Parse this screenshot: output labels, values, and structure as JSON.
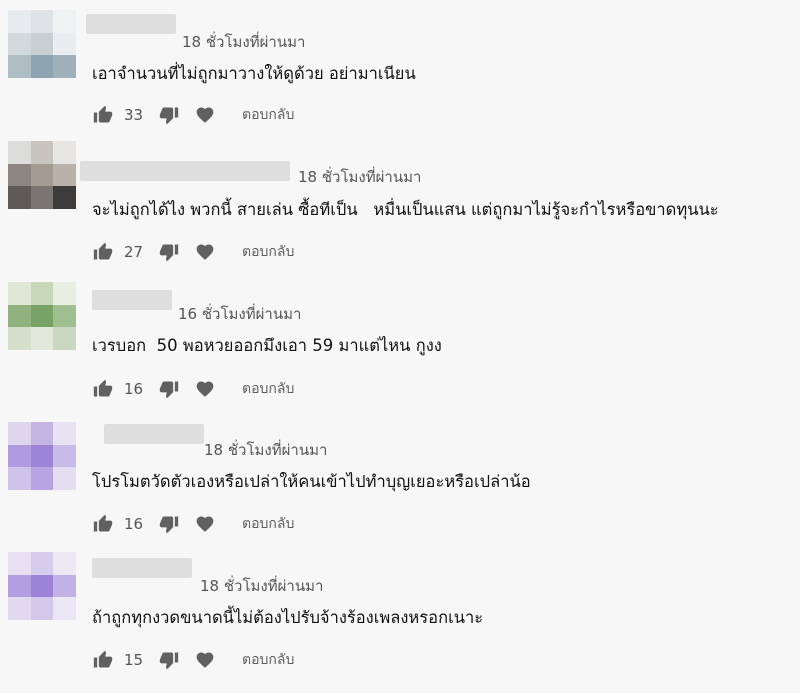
{
  "comments": [
    {
      "time": "18 ชั่วโมงที่ผ่านมา",
      "text": "เอาจำนวนที่ไม่ถูกมาวางให้ดูด้วย อย่ามาเนียน",
      "likes": "33",
      "reply_label": "ตอบกลับ"
    },
    {
      "time": "18 ชั่วโมงที่ผ่านมา",
      "text": "จะไม่ถูกได้ไง พวกนี้ สายเล่น ซื้อทีเป็น   หมื่นเป็นแสน แต่ถูกมาไม่รู้จะกำไรหรือขาดทุนนะ",
      "likes": "27",
      "reply_label": "ตอบกลับ"
    },
    {
      "time": "16 ชั่วโมงที่ผ่านมา",
      "text": "เวรบอก  50 พอหวยออกมึงเอา 59 มาแต่ไหน กูงง",
      "likes": "16",
      "reply_label": "ตอบกลับ"
    },
    {
      "time": "18 ชั่วโมงที่ผ่านมา",
      "text": "โปรโมตวัดตัวเองหรือเปล่าให้คนเข้าไปทำบุญเยอะหรือเปล่าน้อ",
      "likes": "16",
      "reply_label": "ตอบกลับ"
    },
    {
      "time": "18 ชั่วโมงที่ผ่านมา",
      "text": "ถ้าถูกทุกงวดขนาดนี้ไม่ต้องไปรับจ้างร้องเพลงหรอกเนาะ",
      "likes": "15",
      "reply_label": "ตอบกลับ"
    }
  ],
  "icons": {
    "like": "thumb-up-icon",
    "dislike": "thumb-down-icon",
    "heart": "heart-icon"
  },
  "colors": {
    "background": "#f7f7f7",
    "icon": "#606060",
    "text": "#111111",
    "meta": "#555555"
  }
}
